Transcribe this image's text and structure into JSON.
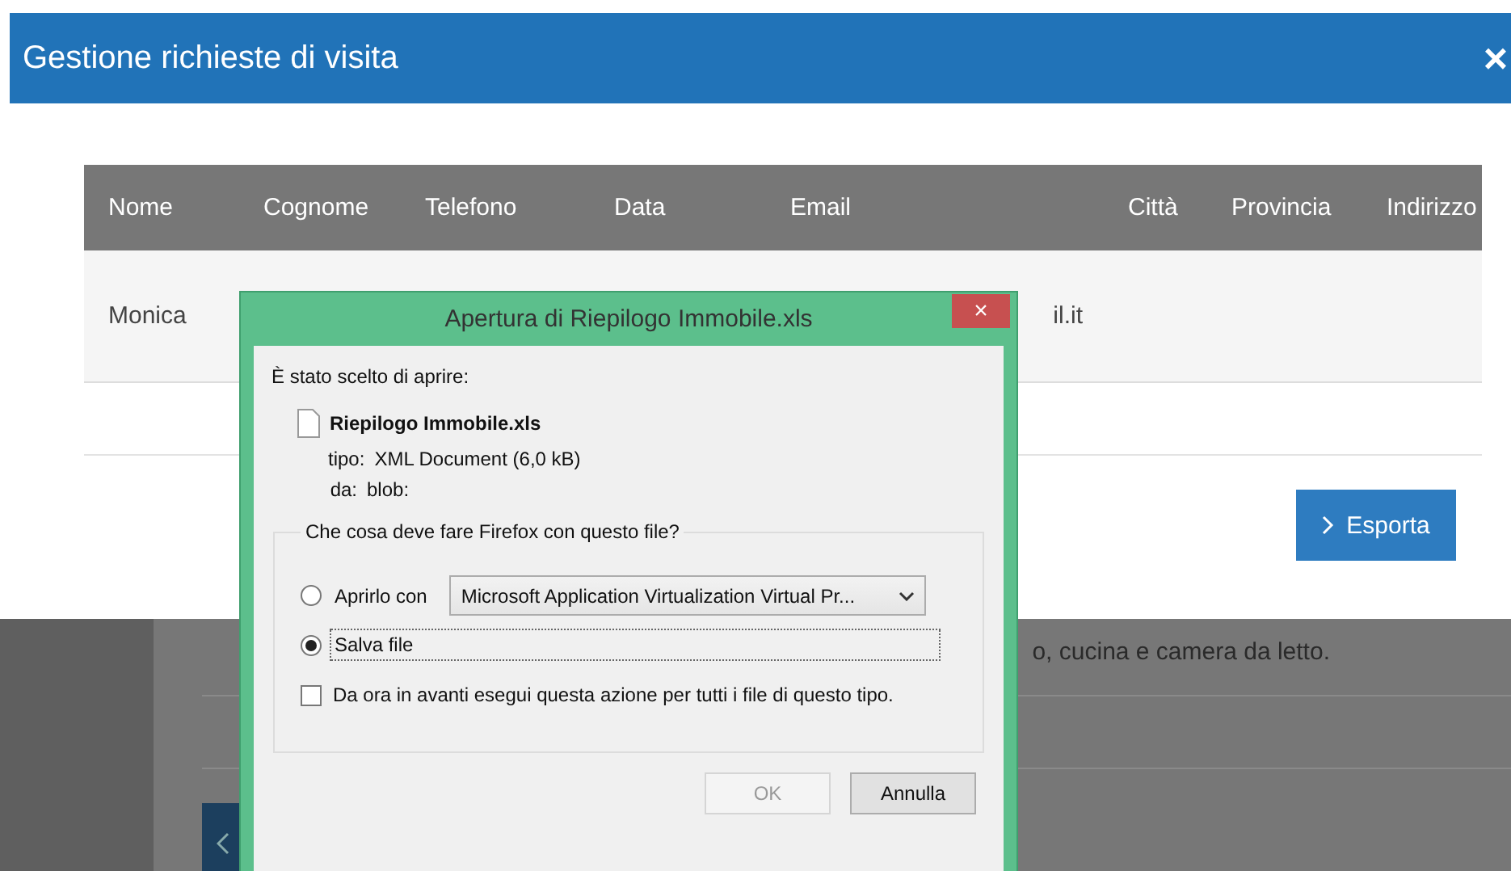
{
  "modal": {
    "title": "Gestione richieste di visita",
    "close": "×",
    "table": {
      "columns": [
        "Nome",
        "Cognome",
        "Telefono",
        "Data",
        "Email",
        "Città",
        "Provincia",
        "Indirizzo"
      ],
      "rows": [
        {
          "cells": [
            "Monica",
            "",
            "",
            "",
            "il.it",
            "",
            "",
            ""
          ]
        }
      ]
    },
    "export_button": "Esporta"
  },
  "background": {
    "text": "o, cucina e camera da letto."
  },
  "dialog": {
    "title": "Apertura di Riepilogo Immobile.xls",
    "close": "×",
    "intro": "È stato scelto di aprire:",
    "file_name": "Riepilogo Immobile.xls",
    "details": [
      {
        "label": "tipo:",
        "value": "XML Document (6,0 kB)"
      },
      {
        "label": "da:",
        "value": "blob:"
      }
    ],
    "question": "Che cosa deve fare Firefox con questo file?",
    "options": [
      {
        "kind": "open_with",
        "label": "Aprirlo con",
        "selected": false,
        "app": "Microsoft Application Virtualization Virtual Pr..."
      },
      {
        "kind": "save",
        "label": "Salva file",
        "selected": true
      }
    ],
    "remember": {
      "label": "Da ora in avanti esegui questa azione per tutti i file di questo tipo.",
      "checked": false
    },
    "buttons": [
      {
        "label": "OK",
        "disabled": true
      },
      {
        "label": "Annulla",
        "disabled": false
      }
    ]
  }
}
